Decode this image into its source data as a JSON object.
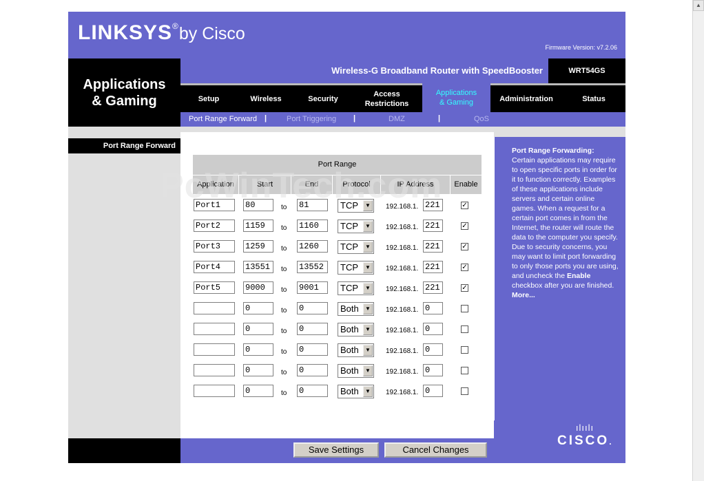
{
  "brand": {
    "logo_main": "LINKSYS",
    "logo_reg": "®",
    "logo_by": "by Cisco",
    "firmware": "Firmware Version: v7.2.06"
  },
  "section_title_line1": "Applications",
  "section_title_line2": "& Gaming",
  "product_name": "Wireless-G Broadband Router with SpeedBooster",
  "model": "WRT54GS",
  "tabs": [
    {
      "label1": "Setup",
      "label2": ""
    },
    {
      "label1": "Wireless",
      "label2": ""
    },
    {
      "label1": "Security",
      "label2": ""
    },
    {
      "label1": "Access",
      "label2": "Restrictions"
    },
    {
      "label1": "Applications",
      "label2": "& Gaming"
    },
    {
      "label1": "Administration",
      "label2": ""
    },
    {
      "label1": "Status",
      "label2": ""
    }
  ],
  "subnav": {
    "items": [
      "Port Range Forward",
      "Port Triggering",
      "DMZ",
      "QoS"
    ],
    "separator": "|"
  },
  "side_label": "Port Range Forward",
  "table": {
    "group_header": "Port Range",
    "columns": [
      "Application",
      "Start",
      "End",
      "Protocol",
      "IP Address",
      "Enable"
    ],
    "to_label": "to",
    "ip_prefix": "192.168.1.",
    "rows": [
      {
        "app": "Port1",
        "start": "80",
        "end": "81",
        "protocol": "TCP",
        "ip": "221",
        "enabled": "✓"
      },
      {
        "app": "Port2",
        "start": "1159",
        "end": "1160",
        "protocol": "TCP",
        "ip": "221",
        "enabled": "✓"
      },
      {
        "app": "Port3",
        "start": "1259",
        "end": "1260",
        "protocol": "TCP",
        "ip": "221",
        "enabled": "✓"
      },
      {
        "app": "Port4",
        "start": "13551",
        "end": "13552",
        "protocol": "TCP",
        "ip": "221",
        "enabled": "✓"
      },
      {
        "app": "Port5",
        "start": "9000",
        "end": "9001",
        "protocol": "TCP",
        "ip": "221",
        "enabled": "✓"
      },
      {
        "app": "",
        "start": "0",
        "end": "0",
        "protocol": "Both",
        "ip": "0",
        "enabled": ""
      },
      {
        "app": "",
        "start": "0",
        "end": "0",
        "protocol": "Both",
        "ip": "0",
        "enabled": ""
      },
      {
        "app": "",
        "start": "0",
        "end": "0",
        "protocol": "Both",
        "ip": "0",
        "enabled": ""
      },
      {
        "app": "",
        "start": "0",
        "end": "0",
        "protocol": "Both",
        "ip": "0",
        "enabled": ""
      },
      {
        "app": "",
        "start": "0",
        "end": "0",
        "protocol": "Both",
        "ip": "0",
        "enabled": ""
      }
    ]
  },
  "help": {
    "title": "Port Range Forwarding:",
    "body1": "Certain applications may require to open specific ports in order for it to function correctly. Examples of these applications include servers and certain online games. When a request for a certain port comes in from the Internet, the router will route the data to the computer you specify. Due to security concerns, you may want to limit port forwarding to only those ports you are using, and uncheck the ",
    "body_bold": "Enable",
    "body2": " checkbox after you are finished.",
    "more": "More..."
  },
  "cisco": {
    "bars": "ılıılı",
    "word": "CISCO",
    "tm": "."
  },
  "buttons": {
    "save": "Save Settings",
    "cancel": "Cancel Changes"
  },
  "watermark": "PcWinTech.com",
  "icons": {
    "scroll_up": "scroll-up-arrow-icon",
    "dropdown": "dropdown-arrow-icon",
    "checkbox": "checkmark-icon"
  }
}
